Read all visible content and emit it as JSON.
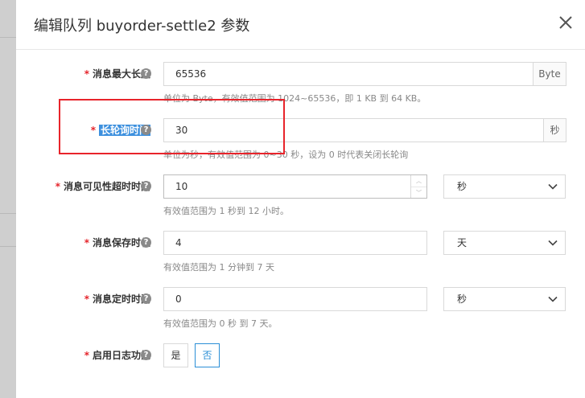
{
  "dialog": {
    "title": "编辑队列 buyorder-settle2 参数"
  },
  "form": {
    "required_mark": "*",
    "help_glyph": "?",
    "max_length": {
      "label": "消息最大长度",
      "value": "65536",
      "unit": "Byte",
      "hint": "单位为 Byte，有效值范围为 1024~65536，即 1 KB 到 64 KB。"
    },
    "long_poll": {
      "label": "长轮询时间",
      "value": "30",
      "unit": "秒",
      "hint": "单位为秒，有效值范围为 0~30 秒，设为 0 时代表关闭长轮询"
    },
    "visibility_timeout": {
      "label": "消息可见性超时时间",
      "value": "10",
      "unit": "秒",
      "spin_up": "︿",
      "spin_down": "﹀",
      "hint": "有效值范围为 1 秒到 12 小时。"
    },
    "retention": {
      "label": "消息保存时长",
      "value": "4",
      "unit": "天",
      "hint": "有效值范围为 1 分钟到 7 天"
    },
    "delay": {
      "label": "消息定时时间",
      "value": "0",
      "unit": "秒",
      "hint": "有效值范围为 0 秒 到 7 天。"
    },
    "logging": {
      "label": "启用日志功能",
      "yes": "是",
      "no": "否",
      "selected": "否"
    }
  },
  "colors": {
    "required": "#e5242b",
    "accent": "#2b8fd6",
    "annotation": "#e8242b",
    "highlight": "#3d90de"
  },
  "icons": [
    "close-icon",
    "help-icon",
    "chevron-down-icon"
  ]
}
